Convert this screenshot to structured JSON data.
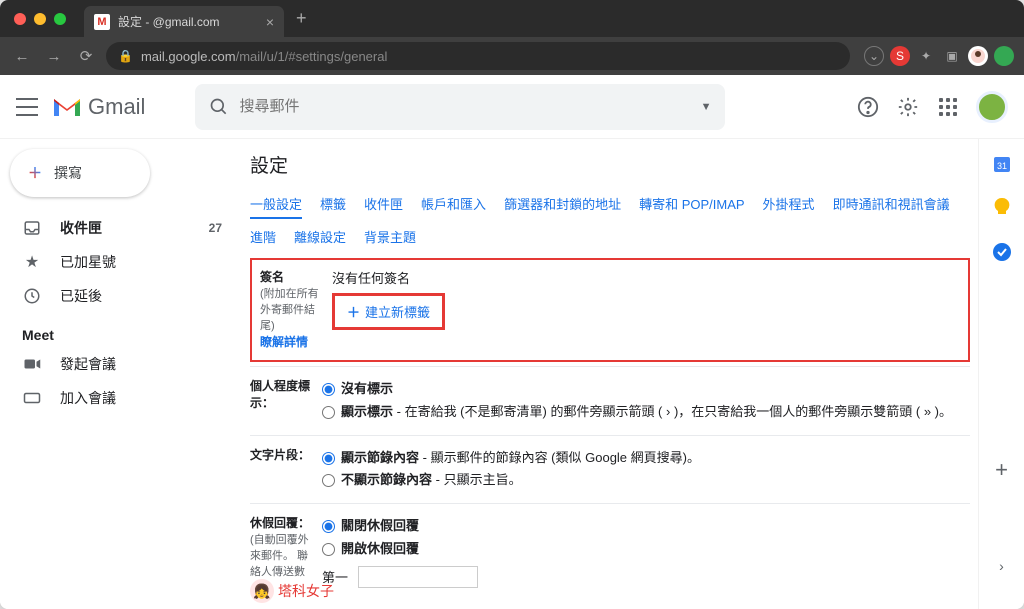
{
  "browser": {
    "tab_title": "設定 - @gmail.com",
    "url_host": "mail.google.com",
    "url_path": "/mail/u/1/#settings/general"
  },
  "header": {
    "brand": "Gmail",
    "search_placeholder": "搜尋郵件"
  },
  "compose_label": "撰寫",
  "sidebar": {
    "items": [
      {
        "label": "收件匣",
        "count": "27"
      },
      {
        "label": "已加星號"
      },
      {
        "label": "已延後"
      }
    ],
    "meet_header": "Meet",
    "meet_items": [
      {
        "label": "發起會議"
      },
      {
        "label": "加入會議"
      }
    ]
  },
  "settings": {
    "title": "設定",
    "tabs": [
      "一般設定",
      "標籤",
      "收件匣",
      "帳戶和匯入",
      "篩選器和封鎖的地址",
      "轉寄和 POP/IMAP",
      "外掛程式",
      "即時通訊和視訊會議"
    ],
    "tabs2": [
      "進階",
      "離線設定",
      "背景主題"
    ],
    "sig": {
      "label": "簽名",
      "sub1": "(附加在所有",
      "sub2": "外寄郵件結",
      "sub3": "尾)",
      "none": "沒有任何簽名",
      "new_btn": "建立新標籤",
      "learn_more": "瞭解詳情"
    },
    "indicator": {
      "label1": "個人程度標",
      "label2": "示：",
      "opt1": "沒有標示",
      "opt2_bold": "顯示標示",
      "opt2_rest": " - 在寄給我 (不是郵寄清單) 的郵件旁顯示箭頭 ( › )，在只寄給我一個人的郵件旁顯示雙箭頭 ( » )。"
    },
    "snippet": {
      "label": "文字片段：",
      "opt1_bold": "顯示節錄內容",
      "opt1_rest": " - 顯示郵件的節錄內容 (類似 Google 網頁搜尋)。",
      "opt2_bold": "不顯示節錄內容",
      "opt2_rest": " - 只顯示主旨。"
    },
    "vacation": {
      "label": "休假回覆：",
      "sub1": "(自動回覆外",
      "sub2": "來郵件。 聯",
      "sub3": "絡人傳送數",
      "opt1": "關閉休假回覆",
      "opt2": "開啟休假回覆",
      "first_day": "第一"
    }
  },
  "watermark": "塔科女子"
}
